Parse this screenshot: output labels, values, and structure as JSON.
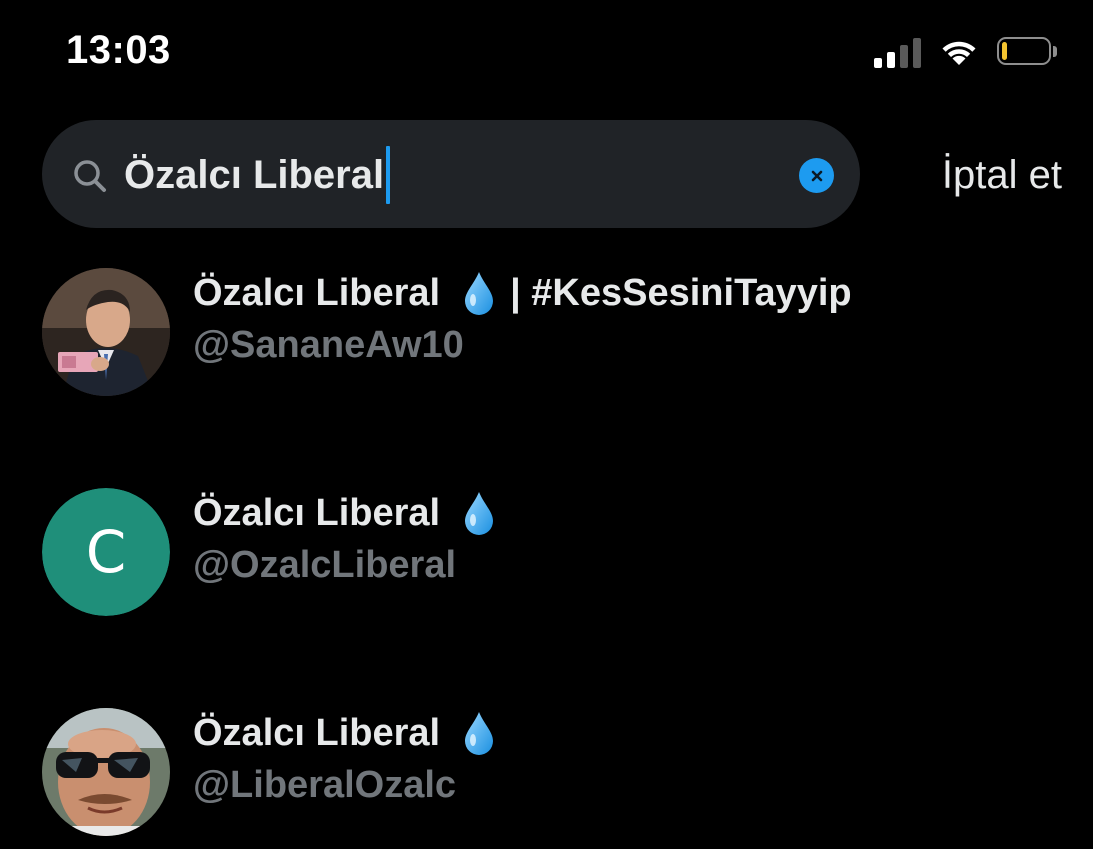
{
  "status_bar": {
    "time": "13:03",
    "signal_icon": "cellular-signal-icon",
    "wifi_icon": "wifi-icon",
    "battery_icon": "battery-low-icon",
    "battery_level": 0.12,
    "battery_color": "#f4c430"
  },
  "search": {
    "query": "Özalcı Liberal",
    "search_icon": "search-icon",
    "clear_icon": "clear-x-icon",
    "cancel_label": "İptal et",
    "accent_color": "#1d9bf0"
  },
  "results": [
    {
      "name": "Özalcı Liberal",
      "name_suffix": "| #KesSesiniTayyip",
      "handle": "@SananeAw10",
      "emoji_icon": "water-drop-icon",
      "avatar": "photo-avatar"
    },
    {
      "name": "Özalcı Liberal",
      "name_suffix": "",
      "handle": "@OzalcLiberal",
      "emoji_icon": "water-drop-icon",
      "avatar_letter": "C",
      "avatar_color": "#1f8f7a"
    },
    {
      "name": "Özalcı Liberal",
      "name_suffix": "",
      "handle": "@LiberalOzalc",
      "emoji_icon": "water-drop-icon",
      "avatar": "photo-avatar"
    }
  ]
}
